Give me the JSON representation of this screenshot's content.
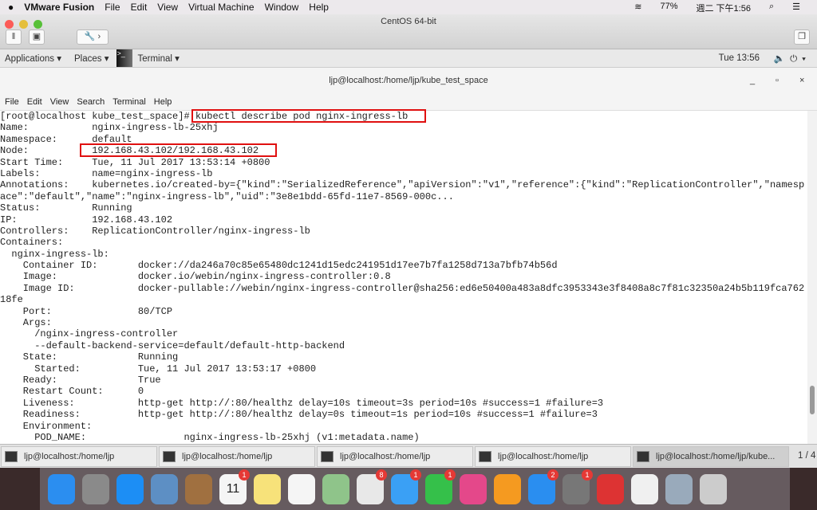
{
  "macos_menu": {
    "app": "VMware Fusion",
    "items": [
      "File",
      "Edit",
      "View",
      "Virtual Machine",
      "Window",
      "Help"
    ],
    "battery": "77%",
    "clock": "週二 下午1:56"
  },
  "vmware": {
    "title": "CentOS 64-bit"
  },
  "gnome": {
    "applications": "Applications ▾",
    "places": "Places ▾",
    "terminal": "Terminal ▾",
    "clock": "Tue 13:56",
    "sys": "🔈⏻▾"
  },
  "terminal": {
    "title": "ljp@localhost:/home/ljp/kube_test_space",
    "minimize": "_",
    "maximize": "▫",
    "close": "×",
    "menu": [
      "File",
      "Edit",
      "View",
      "Search",
      "Terminal",
      "Help"
    ],
    "lines": [
      "[root@localhost kube_test_space]# kubectl describe pod nginx-ingress-lb",
      "Name:           nginx-ingress-lb-25xhj",
      "Namespace:      default",
      "Node:           192.168.43.102/192.168.43.102",
      "Start Time:     Tue, 11 Jul 2017 13:53:14 +0800",
      "Labels:         name=nginx-ingress-lb",
      "Annotations:    kubernetes.io/created-by={\"kind\":\"SerializedReference\",\"apiVersion\":\"v1\",\"reference\":{\"kind\":\"ReplicationController\",\"namesp",
      "ace\":\"default\",\"name\":\"nginx-ingress-lb\",\"uid\":\"3e8e1bdd-65fd-11e7-8569-000c...",
      "Status:         Running",
      "IP:             192.168.43.102",
      "Controllers:    ReplicationController/nginx-ingress-lb",
      "Containers:",
      "  nginx-ingress-lb:",
      "    Container ID:       docker://da246a70c85e65480dc1241d15edc241951d17ee7b7fa1258d713a7bfb74b56d",
      "    Image:              docker.io/webin/nginx-ingress-controller:0.8",
      "    Image ID:           docker-pullable://webin/nginx-ingress-controller@sha256:ed6e50400a483a8dfc3953343e3f8408a8c7f81c32350a24b5b119fca762",
      "18fe",
      "    Port:               80/TCP",
      "    Args:",
      "      /nginx-ingress-controller",
      "      --default-backend-service=default/default-http-backend",
      "    State:              Running",
      "      Started:          Tue, 11 Jul 2017 13:53:17 +0800",
      "    Ready:              True",
      "    Restart Count:      0",
      "    Liveness:           http-get http://:80/healthz delay=10s timeout=3s period=10s #success=1 #failure=3",
      "    Readiness:          http-get http://:80/healthz delay=0s timeout=1s period=10s #success=1 #failure=3",
      "    Environment:",
      "      POD_NAME:                 nginx-ingress-lb-25xhj (v1:metadata.name)"
    ]
  },
  "taskbar": {
    "tasks": [
      "ljp@localhost:/home/ljp",
      "ljp@localhost:/home/ljp",
      "ljp@localhost:/home/ljp",
      "ljp@localhost:/home/ljp",
      "ljp@localhost:/home/ljp/kube..."
    ],
    "pager": "1 / 4"
  },
  "dock": {
    "apps": [
      {
        "name": "finder",
        "color": "#2b8ef0"
      },
      {
        "name": "launchpad",
        "color": "#8a8a8a"
      },
      {
        "name": "safari",
        "color": "#1c8ef5"
      },
      {
        "name": "mail",
        "color": "#5d8fc4"
      },
      {
        "name": "contacts",
        "color": "#a07040"
      },
      {
        "name": "calendar",
        "color": "#f5f5f5",
        "label": "11",
        "badge": "1"
      },
      {
        "name": "notes",
        "color": "#f7e27a"
      },
      {
        "name": "reminders",
        "color": "#f5f5f5"
      },
      {
        "name": "maps",
        "color": "#8fc48a"
      },
      {
        "name": "photos",
        "color": "#e8e8e8",
        "badge": "8"
      },
      {
        "name": "messages",
        "color": "#3aa0f5",
        "badge": "1"
      },
      {
        "name": "facetime",
        "color": "#35c04a",
        "badge": "1"
      },
      {
        "name": "itunes",
        "color": "#e4488a"
      },
      {
        "name": "ibooks",
        "color": "#f59a20"
      },
      {
        "name": "app-store",
        "color": "#2a8ef0",
        "badge": "2"
      },
      {
        "name": "system-preferences",
        "color": "#777",
        "badge": "1"
      },
      {
        "name": "vmware-fusion",
        "color": "#d33"
      },
      {
        "name": "textedit",
        "color": "#f0f0f0"
      },
      {
        "name": "preview",
        "color": "#9ab"
      },
      {
        "name": "trash",
        "color": "#ccc"
      }
    ]
  }
}
